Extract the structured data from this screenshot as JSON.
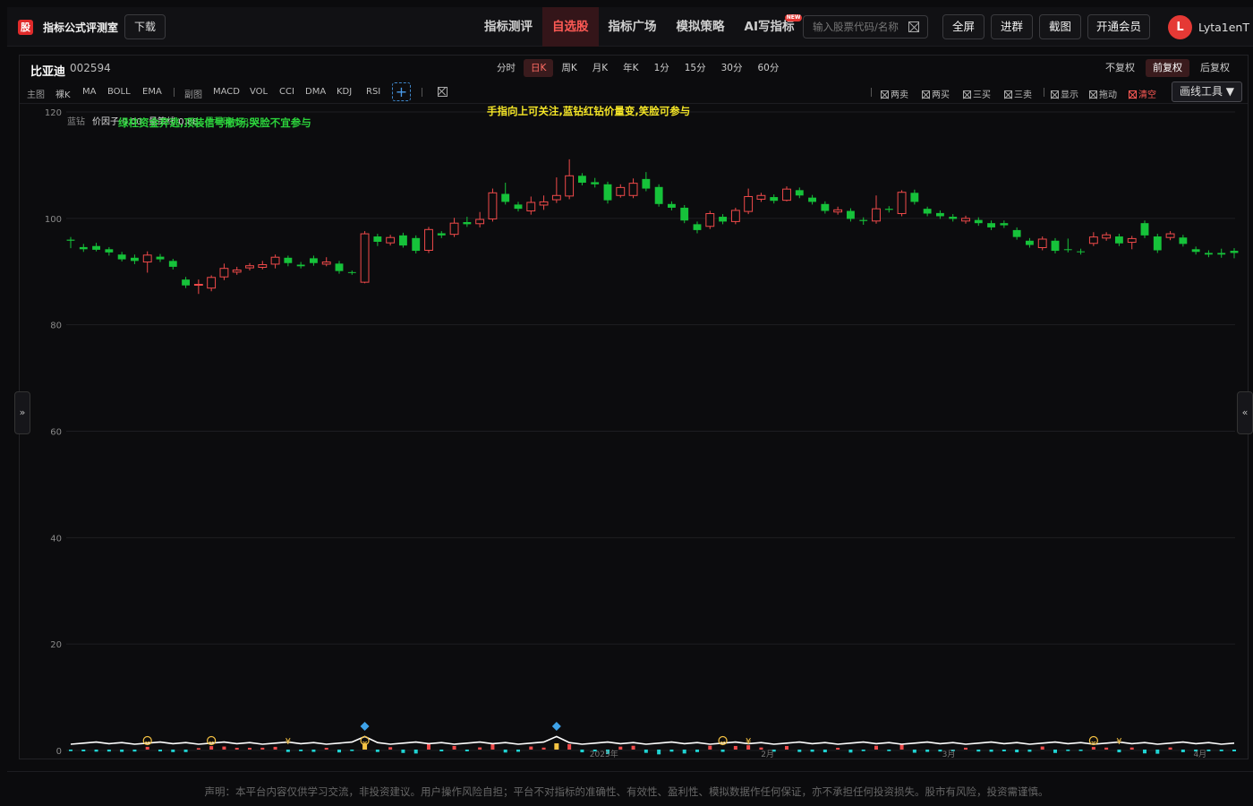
{
  "header": {
    "logo_char": "股",
    "app_title": "指标公式评测室",
    "download_label": "下载",
    "nav": [
      {
        "label": "指标测评",
        "active": false
      },
      {
        "label": "自选股",
        "active": true
      },
      {
        "label": "指标广场",
        "active": false
      },
      {
        "label": "模拟策略",
        "active": false
      },
      {
        "label": "AI写指标",
        "active": false,
        "badge": "NEW"
      }
    ],
    "search_placeholder": "输入股票代码/名称",
    "buttons": {
      "fullscreen": "全屏",
      "join_group": "进群",
      "screenshot": "截图",
      "membership": "开通会员"
    },
    "avatar_letter": "L",
    "username": "Lyta1enT"
  },
  "stock": {
    "name": "比亚迪",
    "code": "002594"
  },
  "periods": [
    {
      "label": "分时",
      "active": false
    },
    {
      "label": "日K",
      "active": true
    },
    {
      "label": "周K",
      "active": false
    },
    {
      "label": "月K",
      "active": false
    },
    {
      "label": "年K",
      "active": false
    },
    {
      "label": "1分",
      "active": false
    },
    {
      "label": "15分",
      "active": false
    },
    {
      "label": "30分",
      "active": false
    },
    {
      "label": "60分",
      "active": false
    }
  ],
  "adjustments": [
    {
      "label": "不复权",
      "active": false
    },
    {
      "label": "前复权",
      "active": true
    },
    {
      "label": "后复权",
      "active": false
    }
  ],
  "toolbar": {
    "main_label": "主图",
    "main_items": [
      "裸K",
      "MA",
      "BOLL",
      "EMA"
    ],
    "sub_label": "副图",
    "sub_items": [
      "MACD",
      "VOL",
      "CCI",
      "DMA",
      "KDJ",
      "RSI"
    ],
    "add_symbol": "+",
    "signal_toggles": [
      "两卖",
      "两买",
      "三买",
      "三卖"
    ],
    "display_toggles": [
      "显示",
      "拖动"
    ],
    "clear_label": "清空",
    "draw_tool_label": "画线工具 ▼"
  },
  "side_tabs": {
    "left": "»",
    "right": "«"
  },
  "chart_data": {
    "type": "candlestick",
    "legend_items": [
      {
        "text": "蓝钻",
        "color": "#888888"
      },
      {
        "text": "价因子 0.00",
        "color": "#dddddd"
      },
      {
        "text": "量策线 0.88",
        "color": "#dddddd"
      },
      {
        "text": "里程碑 0.88",
        "color": "#2bc23b"
      }
    ],
    "annotation_green": "绿柱资金弃逃,顶装信号撤场,哭脸不宜参与",
    "annotation_yellow": "手指向上可关注,蓝钻红钻价量变,笑脸可参与",
    "y_ticks": [
      0,
      20,
      40,
      60,
      80,
      100,
      120
    ],
    "ylim": [
      0,
      120
    ],
    "x_labels": [
      "2025年",
      "2月",
      "3月",
      "4月"
    ],
    "colors": {
      "up": "#f04a4a",
      "down": "#16c23a",
      "grid": "#1e1e22",
      "line": "#ffffff",
      "cyan": "#1fd3d3",
      "marker": "#f6c343",
      "diamond": "#3ea2e8"
    },
    "candles": [
      [
        96.0,
        95.8,
        96.5,
        94.4
      ],
      [
        94.6,
        94.2,
        95.2,
        93.7
      ],
      [
        94.8,
        94.1,
        95.4,
        93.8
      ],
      [
        94.2,
        93.6,
        94.6,
        93.0
      ],
      [
        93.2,
        92.3,
        93.7,
        91.9
      ],
      [
        92.6,
        92.0,
        93.2,
        91.4
      ],
      [
        91.8,
        93.1,
        93.8,
        89.8
      ],
      [
        92.8,
        92.3,
        93.3,
        91.8
      ],
      [
        92.0,
        90.9,
        92.4,
        90.4
      ],
      [
        88.5,
        87.4,
        89.0,
        86.9
      ],
      [
        87.5,
        87.6,
        88.5,
        85.8
      ],
      [
        86.9,
        88.9,
        89.3,
        86.3
      ],
      [
        89.0,
        90.6,
        91.5,
        88.4
      ],
      [
        89.9,
        90.3,
        90.9,
        89.4
      ],
      [
        90.7,
        91.1,
        91.6,
        90.2
      ],
      [
        90.8,
        91.3,
        92.0,
        90.4
      ],
      [
        91.4,
        92.7,
        93.2,
        90.6
      ],
      [
        92.6,
        91.6,
        93.0,
        91.0
      ],
      [
        91.3,
        91.0,
        91.8,
        90.6
      ],
      [
        92.5,
        91.6,
        93.0,
        91.1
      ],
      [
        91.4,
        91.8,
        92.7,
        91.0
      ],
      [
        91.5,
        90.1,
        92.0,
        89.6
      ],
      [
        89.9,
        89.8,
        90.2,
        89.4
      ],
      [
        88.0,
        97.1,
        97.6,
        87.8
      ],
      [
        96.6,
        95.6,
        97.1,
        94.8
      ],
      [
        95.4,
        96.4,
        96.9,
        94.9
      ],
      [
        96.8,
        94.9,
        97.3,
        94.5
      ],
      [
        96.3,
        93.9,
        96.8,
        93.4
      ],
      [
        94.0,
        97.9,
        98.4,
        93.5
      ],
      [
        97.2,
        96.8,
        97.6,
        96.3
      ],
      [
        97.0,
        99.1,
        100.1,
        96.5
      ],
      [
        99.3,
        98.9,
        100.3,
        98.4
      ],
      [
        99.0,
        99.8,
        101.2,
        98.3
      ],
      [
        99.9,
        104.8,
        105.6,
        99.4
      ],
      [
        104.6,
        103.1,
        106.7,
        102.6
      ],
      [
        102.6,
        101.8,
        103.1,
        101.3
      ],
      [
        101.4,
        103.0,
        104.1,
        100.7
      ],
      [
        102.5,
        103.1,
        104.3,
        101.6
      ],
      [
        103.5,
        104.3,
        107.7,
        102.9
      ],
      [
        104.2,
        108.0,
        111.1,
        103.6
      ],
      [
        108.0,
        106.7,
        108.5,
        106.2
      ],
      [
        106.8,
        106.4,
        107.6,
        105.8
      ],
      [
        106.4,
        103.4,
        106.9,
        102.8
      ],
      [
        104.3,
        105.8,
        106.4,
        103.9
      ],
      [
        104.3,
        106.6,
        107.5,
        103.8
      ],
      [
        107.4,
        105.6,
        108.7,
        105.1
      ],
      [
        105.9,
        102.7,
        106.4,
        102.2
      ],
      [
        102.7,
        102.0,
        103.2,
        101.5
      ],
      [
        102.0,
        99.6,
        102.5,
        99.1
      ],
      [
        98.9,
        97.8,
        99.4,
        97.2
      ],
      [
        98.5,
        100.9,
        101.4,
        98.0
      ],
      [
        100.3,
        99.4,
        100.8,
        98.9
      ],
      [
        99.4,
        101.5,
        102.0,
        98.9
      ],
      [
        101.3,
        104.1,
        105.6,
        100.8
      ],
      [
        103.6,
        104.3,
        104.8,
        103.1
      ],
      [
        104.0,
        103.3,
        104.5,
        102.8
      ],
      [
        103.4,
        105.5,
        106.0,
        103.2
      ],
      [
        105.3,
        104.3,
        105.8,
        103.8
      ],
      [
        103.9,
        103.1,
        104.4,
        102.6
      ],
      [
        102.7,
        101.4,
        103.2,
        100.9
      ],
      [
        101.2,
        101.6,
        102.2,
        100.7
      ],
      [
        101.4,
        99.9,
        101.9,
        99.4
      ],
      [
        99.7,
        99.5,
        100.2,
        98.8
      ],
      [
        99.5,
        101.8,
        104.3,
        99.0
      ],
      [
        101.8,
        101.6,
        102.3,
        101.1
      ],
      [
        100.9,
        104.9,
        105.3,
        100.4
      ],
      [
        104.8,
        103.1,
        105.4,
        102.6
      ],
      [
        101.8,
        100.9,
        102.2,
        100.4
      ],
      [
        101.0,
        100.4,
        101.5,
        99.9
      ],
      [
        100.3,
        99.9,
        100.8,
        99.4
      ],
      [
        99.5,
        100.0,
        100.5,
        99.0
      ],
      [
        99.7,
        99.1,
        100.2,
        98.6
      ],
      [
        99.1,
        98.3,
        99.6,
        97.8
      ],
      [
        99.1,
        98.7,
        99.6,
        98.2
      ],
      [
        97.8,
        96.5,
        98.3,
        96.0
      ],
      [
        95.8,
        95.0,
        96.3,
        94.5
      ],
      [
        94.5,
        96.1,
        96.6,
        94.0
      ],
      [
        95.8,
        93.9,
        96.3,
        93.4
      ],
      [
        94.2,
        94.1,
        96.2,
        93.6
      ],
      [
        93.8,
        93.7,
        94.3,
        93.2
      ],
      [
        95.3,
        96.5,
        97.4,
        94.8
      ],
      [
        96.3,
        96.9,
        97.4,
        95.8
      ],
      [
        96.6,
        95.3,
        97.1,
        94.8
      ],
      [
        95.5,
        96.2,
        96.7,
        94.2
      ],
      [
        99.1,
        96.8,
        99.6,
        96.3
      ],
      [
        96.6,
        94.0,
        97.1,
        93.5
      ],
      [
        96.4,
        97.1,
        97.6,
        95.9
      ],
      [
        96.4,
        95.2,
        96.9,
        94.7
      ],
      [
        94.2,
        93.7,
        94.7,
        93.2
      ],
      [
        93.5,
        93.2,
        94.0,
        92.7
      ],
      [
        93.5,
        93.2,
        94.3,
        92.6
      ],
      [
        93.9,
        93.5,
        94.4,
        92.5
      ]
    ],
    "diamonds_at": [
      23,
      38
    ],
    "smiley_at": [
      6,
      11,
      23,
      51,
      80
    ],
    "yen_at": [
      17,
      53,
      82
    ]
  }
}
